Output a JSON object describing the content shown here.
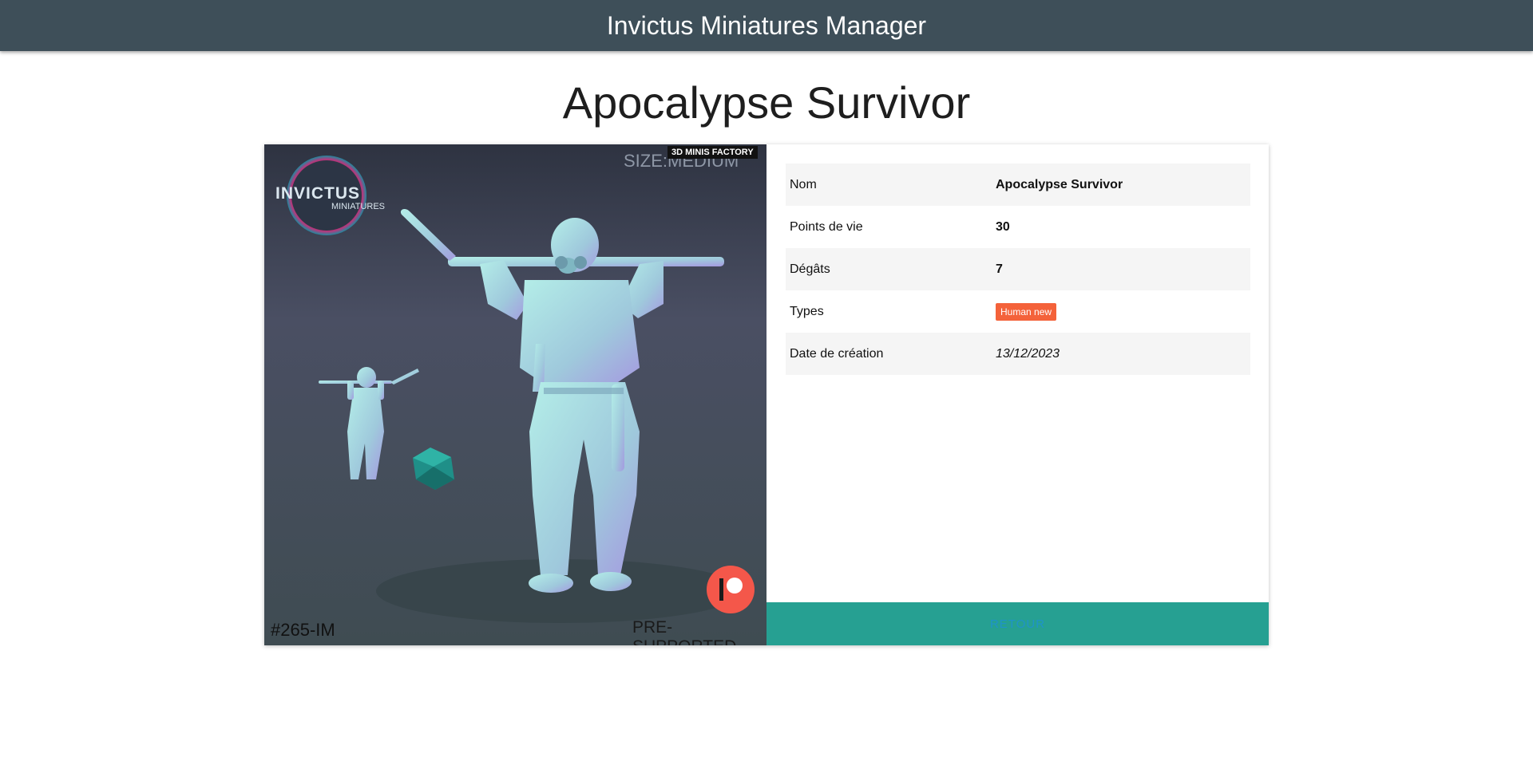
{
  "app": {
    "title": "Invictus Miniatures Manager"
  },
  "page": {
    "title": "Apocalypse Survivor"
  },
  "image": {
    "brand_main": "INVICTUS",
    "brand_sub": "MINIATURES",
    "size_label": "SIZE:MEDIUM",
    "factory_label": "3D MINIS FACTORY",
    "code": "#265-IM",
    "support_label": "PRE-SUPPORTED",
    "badge_icon": "patreon-icon"
  },
  "details": [
    {
      "label": "Nom",
      "value": "Apocalypse Survivor"
    },
    {
      "label": "Points de vie",
      "value": "30"
    },
    {
      "label": "Dégâts",
      "value": "7"
    },
    {
      "label": "Types",
      "value": "Human new"
    },
    {
      "label": "Date de création",
      "value": "13/12/2023"
    }
  ],
  "actions": {
    "back_label": "RETOUR"
  },
  "colors": {
    "navbar": "#3e4f59",
    "badge": "#f4623a",
    "action_bar": "#26a092",
    "link": "#1f93c9"
  }
}
